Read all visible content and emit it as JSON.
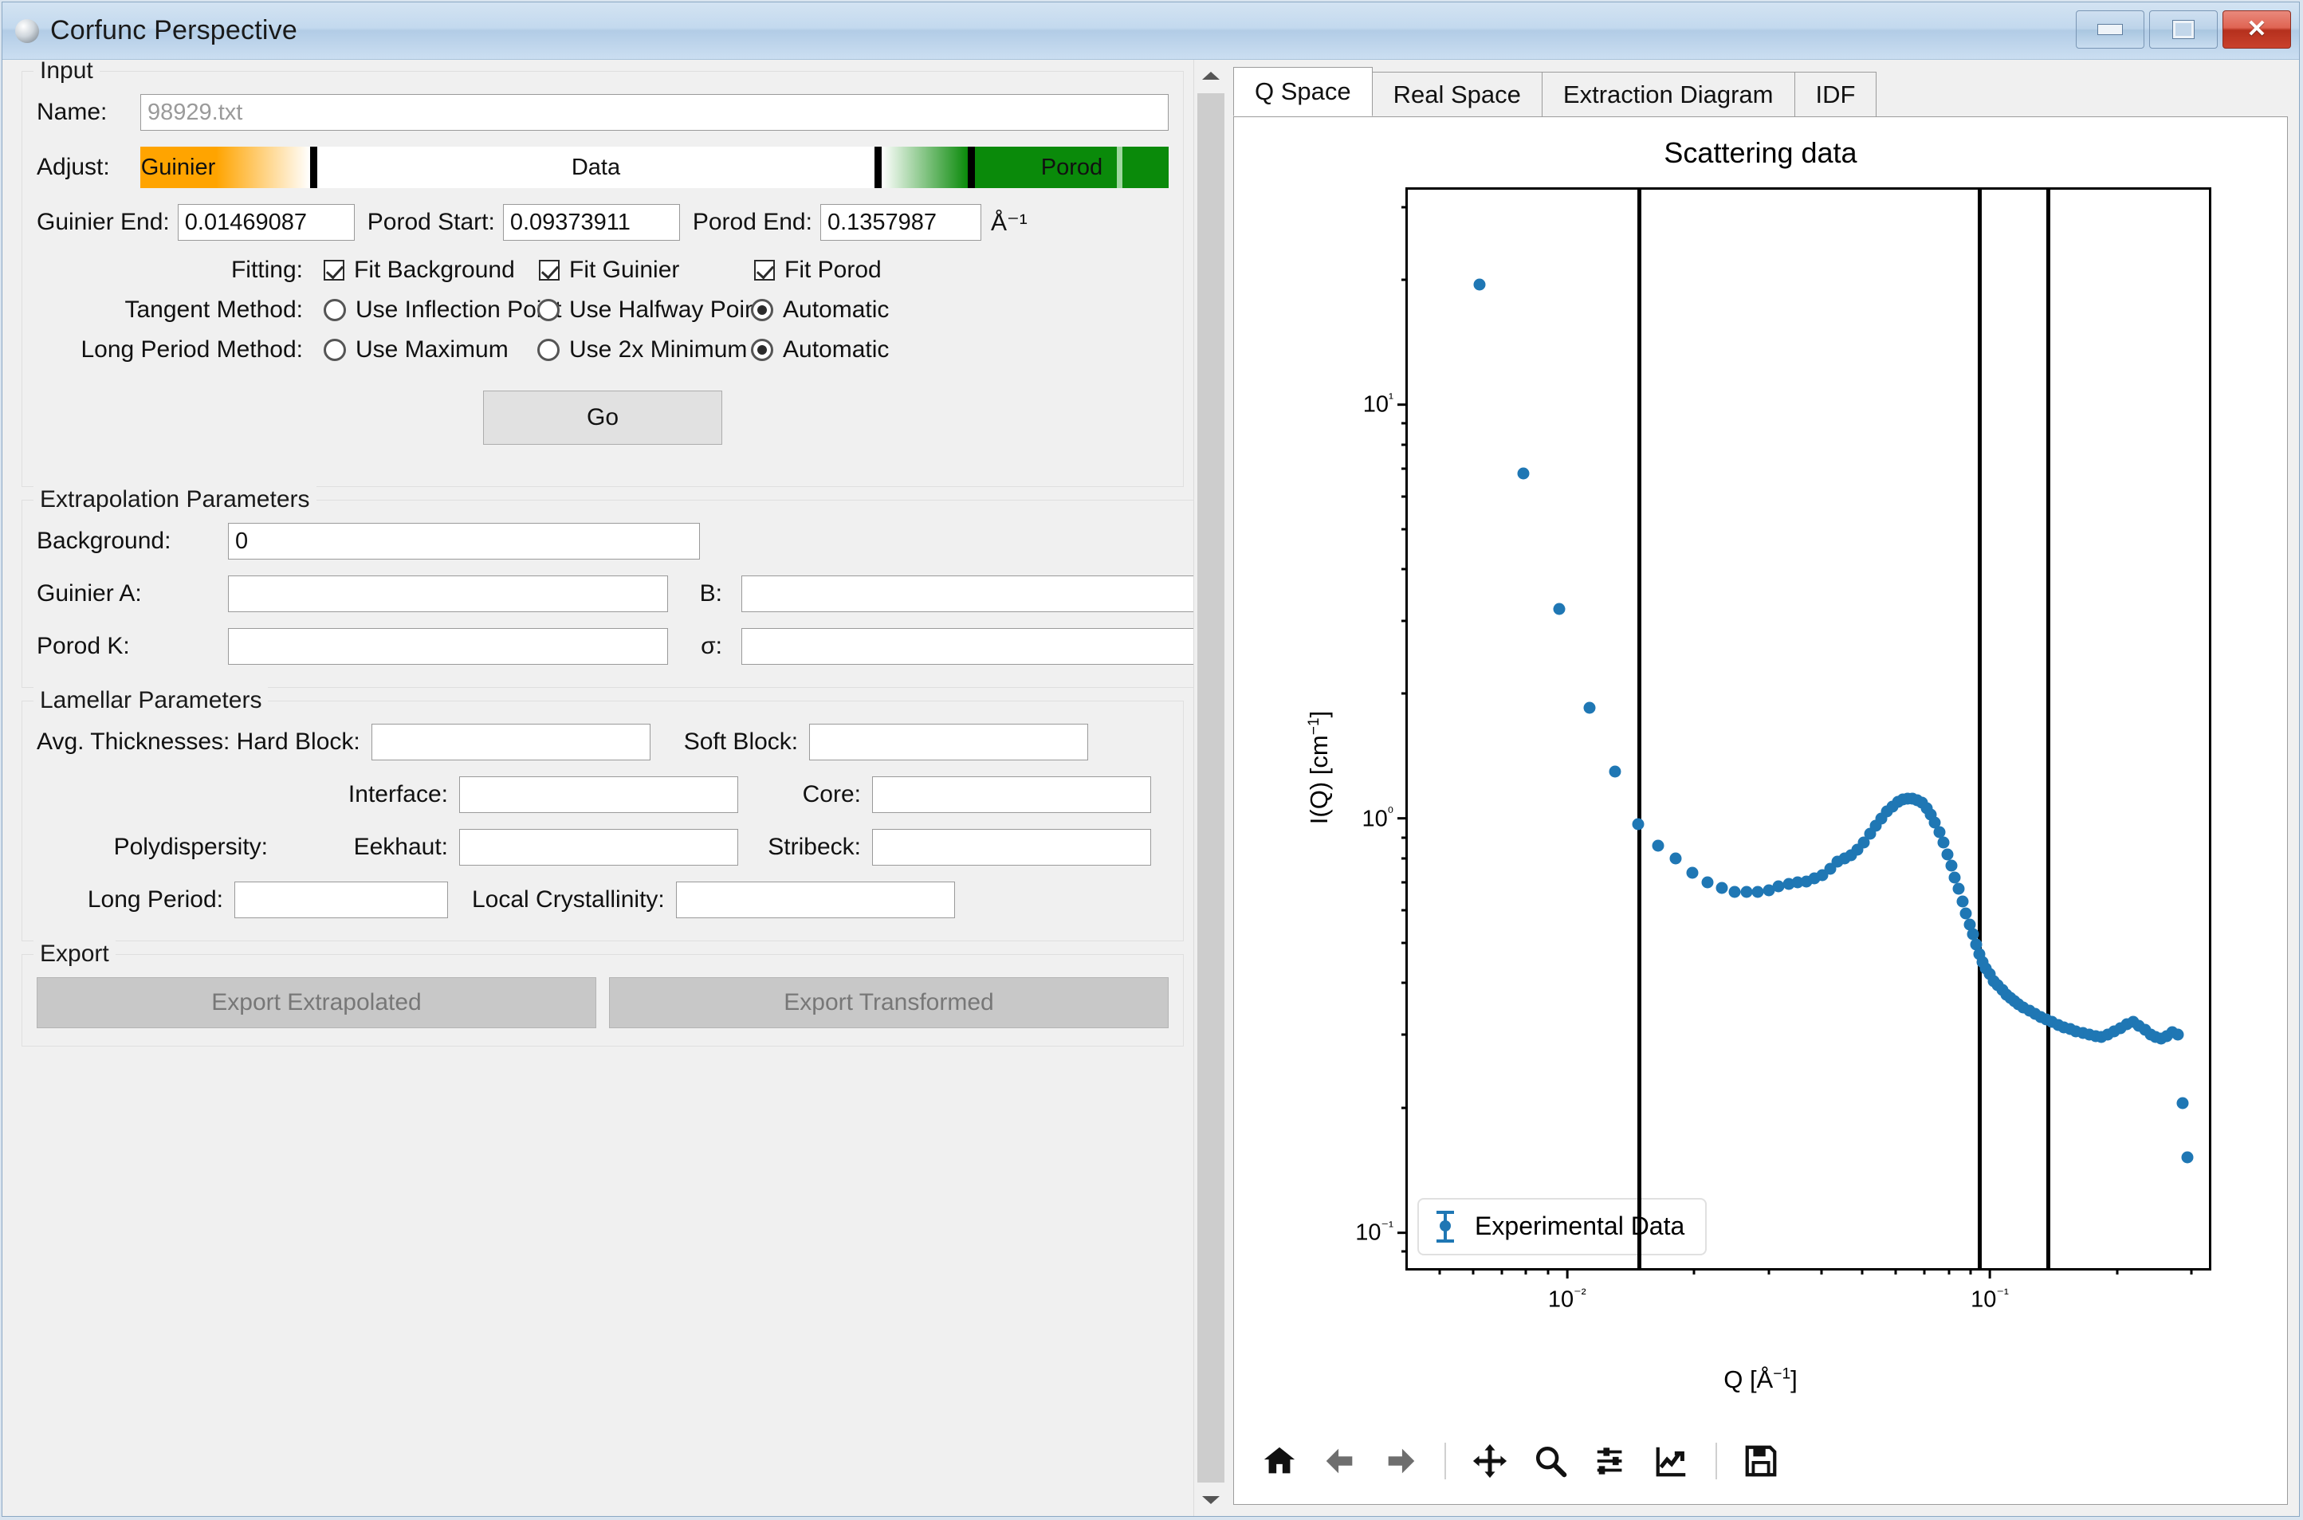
{
  "window": {
    "title": "Corfunc Perspective",
    "minimize_label": "Minimize",
    "maximize_label": "Maximize",
    "close_label": "✕"
  },
  "input": {
    "legend": "Input",
    "name_label": "Name:",
    "name_value": "98929.txt",
    "adjust_label": "Adjust:",
    "adjust_segments": [
      "Guinier",
      "Data",
      "Porod"
    ],
    "guinier_end_label": "Guinier End:",
    "guinier_end_value": "0.01469087",
    "porod_start_label": "Porod Start:",
    "porod_start_value": "0.09373911",
    "porod_end_label": "Porod End:",
    "porod_end_value": "0.1357987",
    "units": "Å⁻¹",
    "fitting_label": "Fitting:",
    "fit_background": "Fit Background",
    "fit_guinier": "Fit Guinier",
    "fit_porod": "Fit Porod",
    "tangent_label": "Tangent Method:",
    "tangent_opt1": "Use Inflection Point",
    "tangent_opt2": "Use Halfway Point",
    "tangent_opt3": "Automatic",
    "long_period_label": "Long Period Method:",
    "lp_opt1": "Use Maximum",
    "lp_opt2": "Use 2x Minimum",
    "lp_opt3": "Automatic",
    "go_label": "Go"
  },
  "extrapolation": {
    "legend": "Extrapolation Parameters",
    "background_label": "Background:",
    "background_value": "0",
    "guinier_a_label": "Guinier A:",
    "guinier_a_value": "",
    "b_label": "B:",
    "b_value": "",
    "porod_k_label": "Porod K:",
    "porod_k_value": "",
    "sigma_label": "σ:",
    "sigma_value": ""
  },
  "lamellar": {
    "legend": "Lamellar Parameters",
    "avg_thick_label": "Avg. Thicknesses: Hard Block:",
    "hard_block_value": "",
    "soft_block_label": "Soft Block:",
    "soft_block_value": "",
    "interface_label": "Interface:",
    "interface_value": "",
    "core_label": "Core:",
    "core_value": "",
    "polydispersity_label": "Polydispersity:",
    "eekhaut_label": "Eekhaut:",
    "eekhaut_value": "",
    "stribeck_label": "Stribeck:",
    "stribeck_value": "",
    "long_period_label": "Long Period:",
    "long_period_value": "",
    "local_cryst_label": "Local Crystallinity:",
    "local_cryst_value": ""
  },
  "export": {
    "legend": "Export",
    "extrapolated_label": "Export Extrapolated",
    "transformed_label": "Export Transformed"
  },
  "tabs": [
    {
      "label": "Q Space",
      "active": true
    },
    {
      "label": "Real Space",
      "active": false
    },
    {
      "label": "Extraction Diagram",
      "active": false
    },
    {
      "label": "IDF",
      "active": false
    }
  ],
  "toolbar": {
    "icons": [
      "home-icon",
      "back-arrow-icon",
      "forward-arrow-icon",
      "pan-icon",
      "zoom-icon",
      "configure-subplots-icon",
      "edit-curves-icon",
      "save-figure-icon"
    ]
  },
  "chart_data": {
    "type": "scatter",
    "title": "Scattering data",
    "xlabel": "Q [Å⁻¹]",
    "ylabel": "I(Q) [cm⁻¹]",
    "xscale": "log",
    "yscale": "log",
    "xlim": [
      0.0042,
      0.33
    ],
    "ylim": [
      0.082,
      33
    ],
    "grid": false,
    "legend_position": "lower left",
    "series": [
      {
        "name": "Experimental Data",
        "color": "#1f77b4",
        "marker": "circle",
        "x": [
          0.0062,
          0.0079,
          0.0096,
          0.0113,
          0.013,
          0.0147,
          0.0164,
          0.0181,
          0.0198,
          0.0215,
          0.0232,
          0.0249,
          0.0266,
          0.0283,
          0.03,
          0.0317,
          0.0334,
          0.0351,
          0.0368,
          0.0385,
          0.0402,
          0.0419,
          0.0436,
          0.0453,
          0.047,
          0.0487,
          0.0504,
          0.0521,
          0.0538,
          0.0555,
          0.0572,
          0.0589,
          0.0606,
          0.0623,
          0.064,
          0.0657,
          0.0674,
          0.0691,
          0.0708,
          0.0725,
          0.0742,
          0.0759,
          0.0776,
          0.0793,
          0.081,
          0.0827,
          0.0844,
          0.0861,
          0.0878,
          0.0895,
          0.0912,
          0.0929,
          0.0946,
          0.0963,
          0.098,
          0.1,
          0.102,
          0.1045,
          0.107,
          0.1095,
          0.112,
          0.1145,
          0.117,
          0.12,
          0.124,
          0.128,
          0.132,
          0.136,
          0.14,
          0.145,
          0.15,
          0.155,
          0.16,
          0.166,
          0.172,
          0.178,
          0.184,
          0.19,
          0.197,
          0.204,
          0.211,
          0.218,
          0.225,
          0.233,
          0.24,
          0.247,
          0.254,
          0.262,
          0.27,
          0.278,
          0.286,
          0.294
        ],
        "y": [
          19.5,
          6.8,
          3.2,
          1.85,
          1.3,
          0.97,
          0.86,
          0.8,
          0.74,
          0.7,
          0.68,
          0.665,
          0.665,
          0.665,
          0.67,
          0.685,
          0.695,
          0.7,
          0.705,
          0.715,
          0.73,
          0.755,
          0.785,
          0.8,
          0.815,
          0.84,
          0.875,
          0.92,
          0.96,
          1.0,
          1.04,
          1.07,
          1.095,
          1.11,
          1.115,
          1.115,
          1.105,
          1.09,
          1.06,
          1.02,
          0.975,
          0.925,
          0.875,
          0.82,
          0.77,
          0.72,
          0.675,
          0.63,
          0.59,
          0.555,
          0.525,
          0.495,
          0.47,
          0.45,
          0.435,
          0.42,
          0.405,
          0.395,
          0.385,
          0.375,
          0.368,
          0.362,
          0.356,
          0.35,
          0.343,
          0.337,
          0.332,
          0.327,
          0.322,
          0.317,
          0.313,
          0.31,
          0.306,
          0.303,
          0.3,
          0.298,
          0.296,
          0.3,
          0.306,
          0.312,
          0.318,
          0.322,
          0.316,
          0.308,
          0.3,
          0.296,
          0.294,
          0.298,
          0.304,
          0.3,
          0.205,
          0.152
        ]
      }
    ],
    "vertical_lines": [
      {
        "q": 0.01469087,
        "name": "guinier-end-line"
      },
      {
        "q": 0.09373911,
        "name": "porod-start-line"
      },
      {
        "q": 0.1357987,
        "name": "porod-end-line"
      }
    ],
    "xticks_major": [
      {
        "value": 0.01,
        "label": "10⁻²"
      },
      {
        "value": 0.1,
        "label": "10⁻¹"
      }
    ],
    "yticks_major": [
      {
        "value": 10,
        "label": "10¹"
      },
      {
        "value": 1,
        "label": "10⁰"
      },
      {
        "value": 0.1,
        "label": "10⁻¹"
      }
    ]
  }
}
